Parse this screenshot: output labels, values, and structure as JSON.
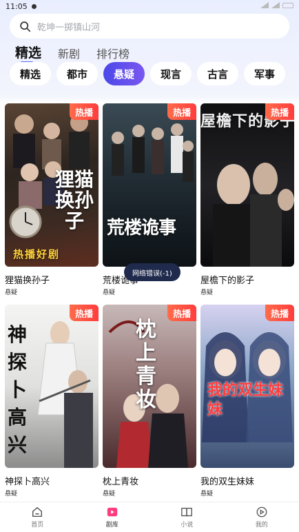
{
  "status_bar": {
    "time": "11:05"
  },
  "search": {
    "placeholder": "乾坤一掷镇山河"
  },
  "top_tabs": [
    {
      "label": "精选",
      "active": true
    },
    {
      "label": "新剧",
      "active": false
    },
    {
      "label": "排行榜",
      "active": false
    }
  ],
  "categories": [
    {
      "label": "精选",
      "active": false
    },
    {
      "label": "都市",
      "active": false
    },
    {
      "label": "悬疑",
      "active": true
    },
    {
      "label": "现言",
      "active": false
    },
    {
      "label": "古言",
      "active": false
    },
    {
      "label": "军事",
      "active": false
    }
  ],
  "dramas": [
    {
      "title": "狸猫换孙子",
      "tag": "悬疑",
      "badge": "热播",
      "cover_text": "狸猫换孙子",
      "cover_caption": "热播好剧"
    },
    {
      "title": "荒楼诡事",
      "tag": "悬疑",
      "badge": "热播",
      "cover_text": "荒楼诡事",
      "cover_caption": ""
    },
    {
      "title": "屋檐下的影子",
      "tag": "悬疑",
      "badge": "热播",
      "cover_text": "屋檐下的影子",
      "cover_caption": ""
    },
    {
      "title": "神探卜高兴",
      "tag": "悬疑",
      "badge": "热播",
      "cover_text": "神探卜高兴",
      "cover_caption": ""
    },
    {
      "title": "枕上青妆",
      "tag": "悬疑",
      "badge": "热播",
      "cover_text": "枕上青妆",
      "cover_caption": ""
    },
    {
      "title": "我的双生妹妹",
      "tag": "悬疑",
      "badge": "热播",
      "cover_text": "我的双生妹妹",
      "cover_caption": ""
    }
  ],
  "toast": {
    "text": "网络错误(-1)"
  },
  "bottom_nav": [
    {
      "label": "首页",
      "icon": "home-icon",
      "active": false
    },
    {
      "label": "剧库",
      "icon": "play-icon",
      "active": true
    },
    {
      "label": "小说",
      "icon": "book-icon",
      "active": false
    },
    {
      "label": "我的",
      "icon": "profile-icon",
      "active": false
    }
  ],
  "colors": {
    "accent": "#5b4ff0",
    "hot_badge": "#ff4a3d",
    "nav_active": "#ff3d7f"
  }
}
